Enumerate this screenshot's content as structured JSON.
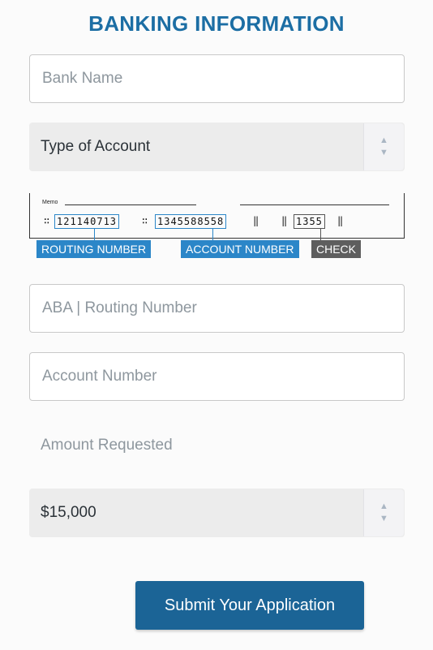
{
  "title": "BANKING INFORMATION",
  "form": {
    "bank_name_placeholder": "Bank Name",
    "account_type_value": "Type of Account",
    "routing_placeholder": "ABA | Routing Number",
    "account_number_placeholder": "Account Number",
    "amount_label": "Amount Requested",
    "amount_value": "$15,000",
    "submit_label": "Submit Your Application"
  },
  "check_diagram": {
    "memo_label": "Memo",
    "routing_digits": "121140713",
    "account_digits": "1345588558",
    "check_digits": "1355",
    "routing_tag": "ROUTING NUMBER",
    "account_tag": "ACCOUNT NUMBER",
    "check_tag": "CHECK"
  },
  "colors": {
    "title": "#1c6ea4",
    "tag_blue": "#2b86c8",
    "tag_gray": "#5e5e5e",
    "button": "#1b6496"
  },
  "icons": {
    "select_arrows": "up-down-arrows-icon"
  }
}
